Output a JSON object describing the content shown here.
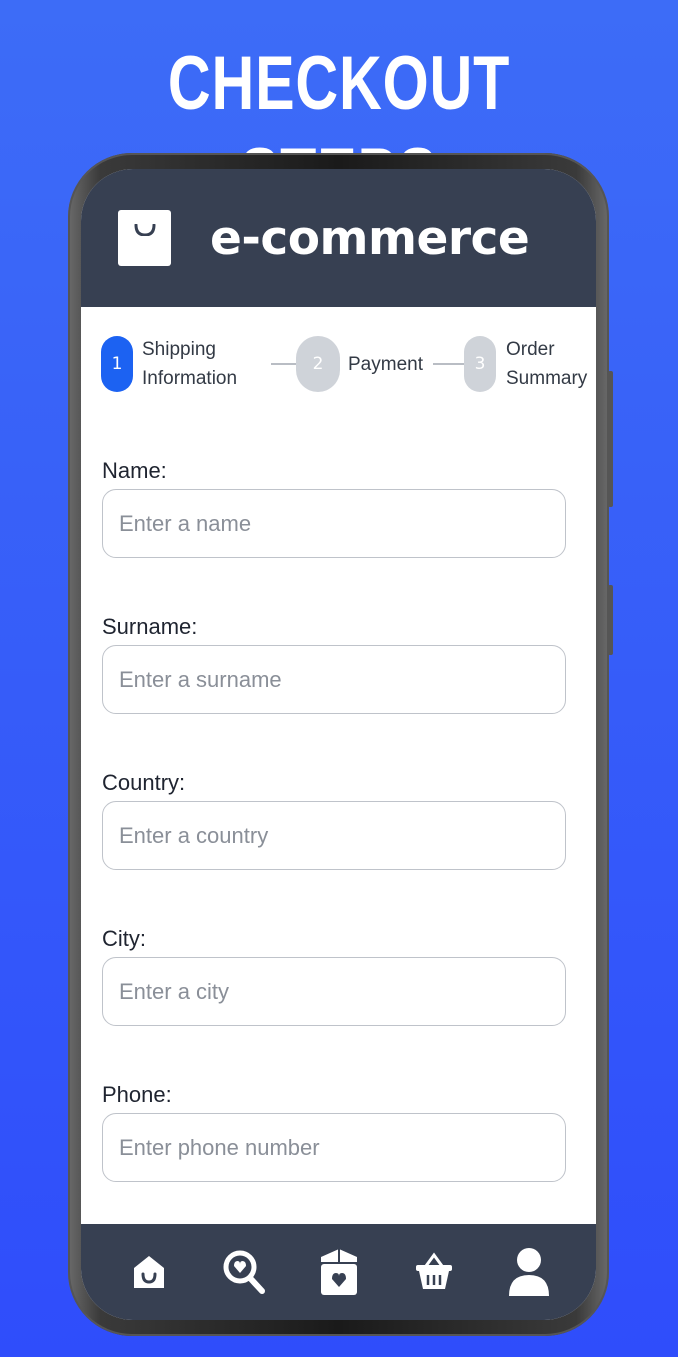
{
  "headline": "CHECKOUT STEPS",
  "app": {
    "brand": "e-commerce",
    "logo_icon": "shopping-bag-icon"
  },
  "stepper": {
    "steps": [
      {
        "number": "1",
        "line1": "Shipping",
        "line2": "Information",
        "state": "active"
      },
      {
        "number": "2",
        "line1": "Payment",
        "line2": "",
        "state": "inactive"
      },
      {
        "number": "3",
        "line1": "Order",
        "line2": "Summary",
        "state": "inactive"
      }
    ]
  },
  "form": {
    "fields": [
      {
        "label": "Name:",
        "placeholder": "Enter a name",
        "value": ""
      },
      {
        "label": "Surname:",
        "placeholder": "Enter a surname",
        "value": ""
      },
      {
        "label": "Country:",
        "placeholder": "Enter a country",
        "value": ""
      },
      {
        "label": "City:",
        "placeholder": "Enter a city",
        "value": ""
      },
      {
        "label": "Phone:",
        "placeholder": "Enter phone number",
        "value": ""
      }
    ]
  },
  "bottom_nav": {
    "items": [
      {
        "icon": "home-icon"
      },
      {
        "icon": "search-icon"
      },
      {
        "icon": "wishlist-box-icon"
      },
      {
        "icon": "basket-icon"
      },
      {
        "icon": "user-icon"
      }
    ]
  },
  "colors": {
    "background": "#3d6cf7",
    "header": "#374052",
    "accent": "#1c62f2",
    "inactive_step": "#cfd3d9"
  }
}
